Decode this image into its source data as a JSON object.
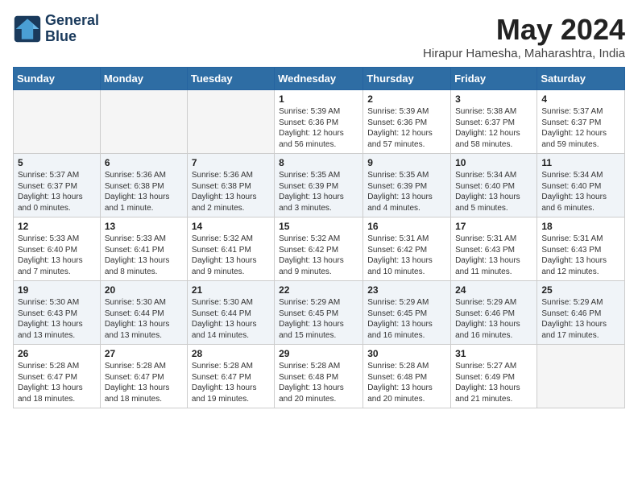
{
  "header": {
    "logo_line1": "General",
    "logo_line2": "Blue",
    "month_year": "May 2024",
    "location": "Hirapur Hamesha, Maharashtra, India"
  },
  "days_of_week": [
    "Sunday",
    "Monday",
    "Tuesday",
    "Wednesday",
    "Thursday",
    "Friday",
    "Saturday"
  ],
  "weeks": [
    [
      {
        "day": "",
        "info": ""
      },
      {
        "day": "",
        "info": ""
      },
      {
        "day": "",
        "info": ""
      },
      {
        "day": "1",
        "info": "Sunrise: 5:39 AM\nSunset: 6:36 PM\nDaylight: 12 hours\nand 56 minutes."
      },
      {
        "day": "2",
        "info": "Sunrise: 5:39 AM\nSunset: 6:36 PM\nDaylight: 12 hours\nand 57 minutes."
      },
      {
        "day": "3",
        "info": "Sunrise: 5:38 AM\nSunset: 6:37 PM\nDaylight: 12 hours\nand 58 minutes."
      },
      {
        "day": "4",
        "info": "Sunrise: 5:37 AM\nSunset: 6:37 PM\nDaylight: 12 hours\nand 59 minutes."
      }
    ],
    [
      {
        "day": "5",
        "info": "Sunrise: 5:37 AM\nSunset: 6:37 PM\nDaylight: 13 hours\nand 0 minutes."
      },
      {
        "day": "6",
        "info": "Sunrise: 5:36 AM\nSunset: 6:38 PM\nDaylight: 13 hours\nand 1 minute."
      },
      {
        "day": "7",
        "info": "Sunrise: 5:36 AM\nSunset: 6:38 PM\nDaylight: 13 hours\nand 2 minutes."
      },
      {
        "day": "8",
        "info": "Sunrise: 5:35 AM\nSunset: 6:39 PM\nDaylight: 13 hours\nand 3 minutes."
      },
      {
        "day": "9",
        "info": "Sunrise: 5:35 AM\nSunset: 6:39 PM\nDaylight: 13 hours\nand 4 minutes."
      },
      {
        "day": "10",
        "info": "Sunrise: 5:34 AM\nSunset: 6:40 PM\nDaylight: 13 hours\nand 5 minutes."
      },
      {
        "day": "11",
        "info": "Sunrise: 5:34 AM\nSunset: 6:40 PM\nDaylight: 13 hours\nand 6 minutes."
      }
    ],
    [
      {
        "day": "12",
        "info": "Sunrise: 5:33 AM\nSunset: 6:40 PM\nDaylight: 13 hours\nand 7 minutes."
      },
      {
        "day": "13",
        "info": "Sunrise: 5:33 AM\nSunset: 6:41 PM\nDaylight: 13 hours\nand 8 minutes."
      },
      {
        "day": "14",
        "info": "Sunrise: 5:32 AM\nSunset: 6:41 PM\nDaylight: 13 hours\nand 9 minutes."
      },
      {
        "day": "15",
        "info": "Sunrise: 5:32 AM\nSunset: 6:42 PM\nDaylight: 13 hours\nand 9 minutes."
      },
      {
        "day": "16",
        "info": "Sunrise: 5:31 AM\nSunset: 6:42 PM\nDaylight: 13 hours\nand 10 minutes."
      },
      {
        "day": "17",
        "info": "Sunrise: 5:31 AM\nSunset: 6:43 PM\nDaylight: 13 hours\nand 11 minutes."
      },
      {
        "day": "18",
        "info": "Sunrise: 5:31 AM\nSunset: 6:43 PM\nDaylight: 13 hours\nand 12 minutes."
      }
    ],
    [
      {
        "day": "19",
        "info": "Sunrise: 5:30 AM\nSunset: 6:43 PM\nDaylight: 13 hours\nand 13 minutes."
      },
      {
        "day": "20",
        "info": "Sunrise: 5:30 AM\nSunset: 6:44 PM\nDaylight: 13 hours\nand 13 minutes."
      },
      {
        "day": "21",
        "info": "Sunrise: 5:30 AM\nSunset: 6:44 PM\nDaylight: 13 hours\nand 14 minutes."
      },
      {
        "day": "22",
        "info": "Sunrise: 5:29 AM\nSunset: 6:45 PM\nDaylight: 13 hours\nand 15 minutes."
      },
      {
        "day": "23",
        "info": "Sunrise: 5:29 AM\nSunset: 6:45 PM\nDaylight: 13 hours\nand 16 minutes."
      },
      {
        "day": "24",
        "info": "Sunrise: 5:29 AM\nSunset: 6:46 PM\nDaylight: 13 hours\nand 16 minutes."
      },
      {
        "day": "25",
        "info": "Sunrise: 5:29 AM\nSunset: 6:46 PM\nDaylight: 13 hours\nand 17 minutes."
      }
    ],
    [
      {
        "day": "26",
        "info": "Sunrise: 5:28 AM\nSunset: 6:47 PM\nDaylight: 13 hours\nand 18 minutes."
      },
      {
        "day": "27",
        "info": "Sunrise: 5:28 AM\nSunset: 6:47 PM\nDaylight: 13 hours\nand 18 minutes."
      },
      {
        "day": "28",
        "info": "Sunrise: 5:28 AM\nSunset: 6:47 PM\nDaylight: 13 hours\nand 19 minutes."
      },
      {
        "day": "29",
        "info": "Sunrise: 5:28 AM\nSunset: 6:48 PM\nDaylight: 13 hours\nand 20 minutes."
      },
      {
        "day": "30",
        "info": "Sunrise: 5:28 AM\nSunset: 6:48 PM\nDaylight: 13 hours\nand 20 minutes."
      },
      {
        "day": "31",
        "info": "Sunrise: 5:27 AM\nSunset: 6:49 PM\nDaylight: 13 hours\nand 21 minutes."
      },
      {
        "day": "",
        "info": ""
      }
    ]
  ]
}
